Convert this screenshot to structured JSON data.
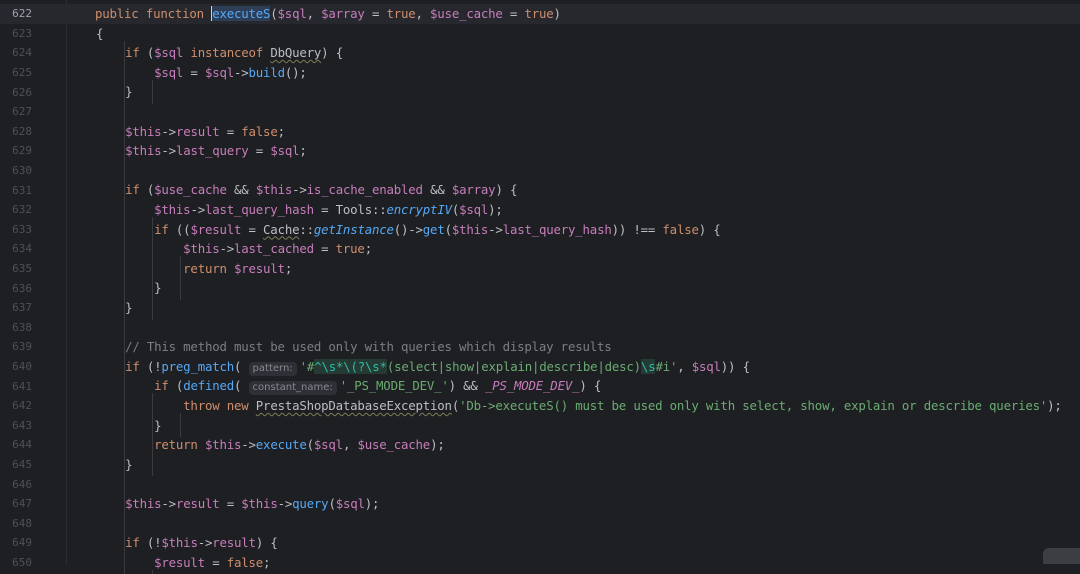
{
  "editor": {
    "current_line": "622",
    "lines": [
      {
        "n": "622",
        "t": "    public function executeS($sql, $array = true, $use_cache = true)"
      },
      {
        "n": "623",
        "t": "    {"
      },
      {
        "n": "624",
        "t": "        if ($sql instanceof DbQuery) {"
      },
      {
        "n": "625",
        "t": "            $sql = $sql->build();"
      },
      {
        "n": "626",
        "t": "        }"
      },
      {
        "n": "627",
        "t": ""
      },
      {
        "n": "628",
        "t": "        $this->result = false;"
      },
      {
        "n": "629",
        "t": "        $this->last_query = $sql;"
      },
      {
        "n": "630",
        "t": ""
      },
      {
        "n": "631",
        "t": "        if ($use_cache && $this->is_cache_enabled && $array) {"
      },
      {
        "n": "632",
        "t": "            $this->last_query_hash = Tools::encryptIV($sql);"
      },
      {
        "n": "633",
        "t": "            if (($result = Cache::getInstance()->get($this->last_query_hash)) !== false) {"
      },
      {
        "n": "634",
        "t": "                $this->last_cached = true;"
      },
      {
        "n": "635",
        "t": "                return $result;"
      },
      {
        "n": "636",
        "t": "            }"
      },
      {
        "n": "637",
        "t": "        }"
      },
      {
        "n": "638",
        "t": ""
      },
      {
        "n": "639",
        "t": "        // This method must be used only with queries which display results"
      },
      {
        "n": "640",
        "t": "        if (!preg_match( pattern: '#^\\s*\\(?\\s*(select|show|explain|describe|desc)\\s#i', $sql)) {"
      },
      {
        "n": "641",
        "t": "            if (defined( constant_name: '_PS_MODE_DEV_') && _PS_MODE_DEV_) {"
      },
      {
        "n": "642",
        "t": "                throw new PrestaShopDatabaseException('Db->executeS() must be used only with select, show, explain or describe queries');"
      },
      {
        "n": "643",
        "t": "            }"
      },
      {
        "n": "644",
        "t": "            return $this->execute($sql, $use_cache);"
      },
      {
        "n": "645",
        "t": "        }"
      },
      {
        "n": "646",
        "t": ""
      },
      {
        "n": "647",
        "t": "        $this->result = $this->query($sql);"
      },
      {
        "n": "648",
        "t": ""
      },
      {
        "n": "649",
        "t": "        if (!$this->result) {"
      },
      {
        "n": "650",
        "t": "            $result = false;"
      }
    ],
    "tokens": {
      "kw_public": "public",
      "kw_function": "function",
      "fn_executeS": "executeS",
      "kw_if": "if",
      "kw_instanceof": "instanceof",
      "cls_DbQuery": "DbQuery",
      "fn_build": "build",
      "kw_false": "false",
      "kw_true": "true",
      "cls_Tools": "Tools",
      "fn_encryptIV": "encryptIV",
      "cls_Cache": "Cache",
      "fn_getInstance": "getInstance",
      "fn_get": "get",
      "kw_return": "return",
      "comment_639": "// This method must be used only with queries which display results",
      "fn_preg_match": "preg_match",
      "hint_pattern": "pattern:",
      "fn_defined": "defined",
      "hint_constant_name": "constant_name:",
      "str_ps_mode": "'_PS_MODE_DEV_'",
      "const_ps_mode": "_PS_MODE_DEV_",
      "kw_throw": "throw",
      "kw_new": "new",
      "cls_exception": "PrestaShopDatabaseException",
      "str_exception": "'Db->executeS() must be used only with select, show, explain or describe queries'",
      "fn_execute": "execute",
      "fn_query": "query"
    }
  }
}
